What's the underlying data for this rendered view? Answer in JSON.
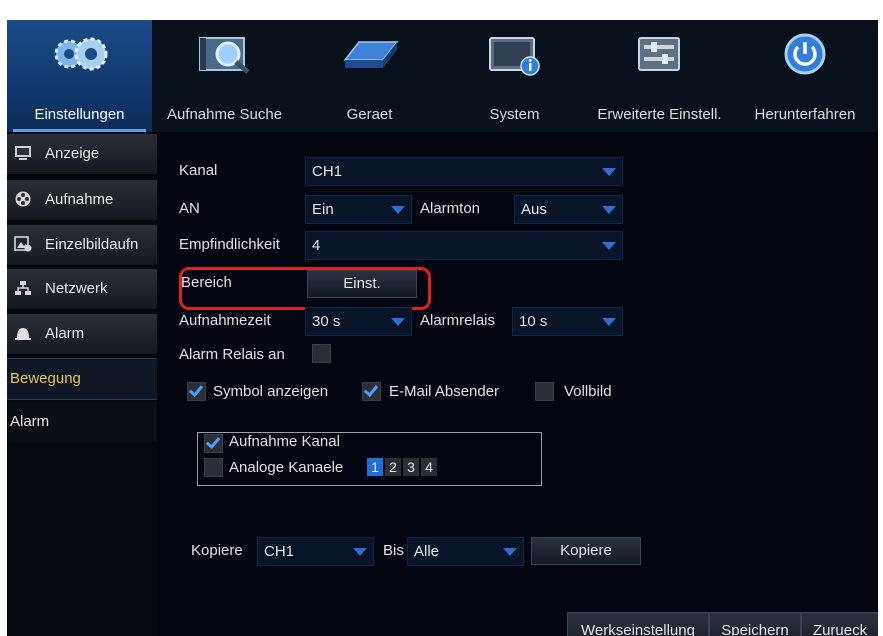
{
  "topnav": {
    "tabs": [
      {
        "label": "Einstellungen",
        "icon": "gears-icon"
      },
      {
        "label": "Aufnahme Suche",
        "icon": "search-film-icon"
      },
      {
        "label": "Geraet",
        "icon": "hard-drive-icon"
      },
      {
        "label": "System",
        "icon": "system-info-icon"
      },
      {
        "label": "Erweiterte Einstell.",
        "icon": "advanced-settings-icon"
      },
      {
        "label": "Herunterfahren",
        "icon": "power-icon"
      }
    ]
  },
  "sidebar": {
    "items": [
      {
        "label": "Anzeige",
        "icon": "monitor-icon"
      },
      {
        "label": "Aufnahme",
        "icon": "film-reel-icon"
      },
      {
        "label": "Einzelbildaufn",
        "icon": "snapshot-icon"
      },
      {
        "label": "Netzwerk",
        "icon": "network-icon"
      },
      {
        "label": "Alarm",
        "icon": "alarm-bell-icon"
      }
    ],
    "subitems": [
      {
        "label": "Bewegung"
      },
      {
        "label": "Alarm"
      }
    ]
  },
  "form": {
    "kanal_label": "Kanal",
    "kanal_value": "CH1",
    "an_label": "AN",
    "an_value": "Ein",
    "alarmton_label": "Alarmton",
    "alarmton_value": "Aus",
    "empf_label": "Empfindlichkeit",
    "empf_value": "4",
    "bereich_label": "Bereich",
    "bereich_button": "Einst.",
    "aufnahmezeit_label": "Aufnahmezeit",
    "aufnahmezeit_value": "30 s",
    "alarmrelais_label": "Alarmrelais",
    "alarmrelais_value": "10 s",
    "alarm_relais_an_label": "Alarm Relais an",
    "symbol_label": "Symbol anzeigen",
    "email_label": "E-Mail Absender",
    "vollbild_label": "Vollbild",
    "aufnahme_kanal_label": "Aufnahme Kanal",
    "analoge_label": "Analoge Kanaele",
    "channels": [
      "1",
      "2",
      "3",
      "4"
    ],
    "kopiere_label": "Kopiere",
    "kopiere_from": "CH1",
    "bis_label": "Bis",
    "bis_value": "Alle",
    "kopiere_button": "Kopiere"
  },
  "footer": {
    "reset": "Werkseinstellung",
    "save": "Speichern",
    "back": "Zurueck"
  },
  "colors": {
    "accent": "#2c6fd3",
    "highlight": "#e0201d",
    "active_sub": "#e0c85a"
  }
}
